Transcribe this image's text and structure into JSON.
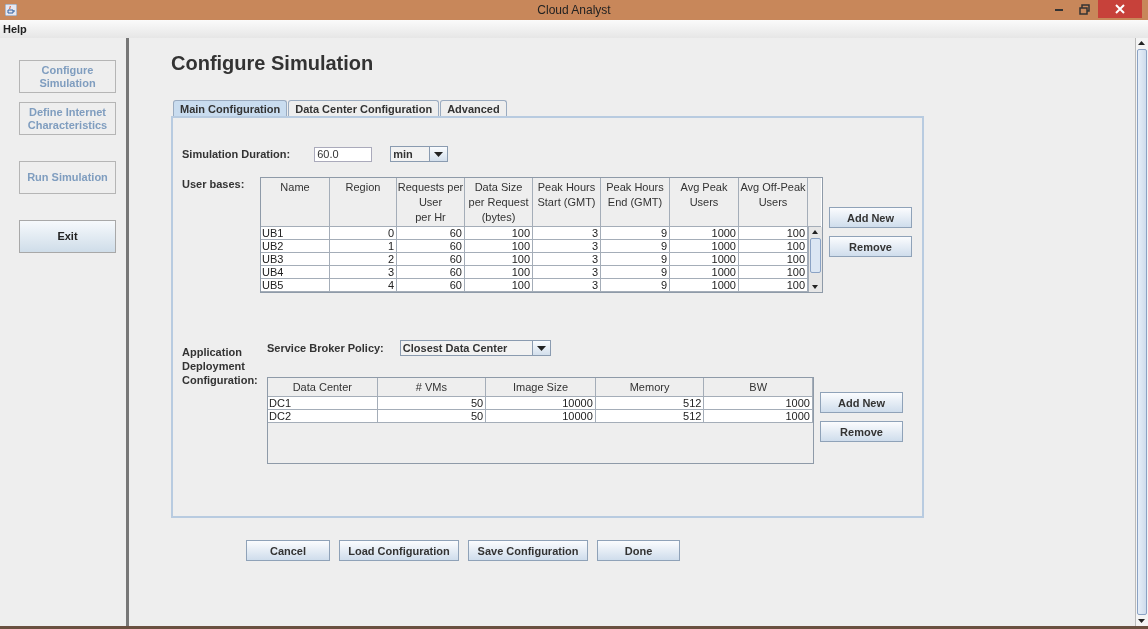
{
  "window": {
    "title": "Cloud Analyst"
  },
  "menu": [
    "Help"
  ],
  "sidebar": {
    "buttons": [
      {
        "label": "Configure\nSimulation",
        "disabled": true
      },
      {
        "label": "Define Internet\nCharacteristics",
        "disabled": true
      },
      {
        "label": "Run Simulation",
        "disabled": true
      },
      {
        "label": "Exit",
        "disabled": false
      }
    ]
  },
  "page_title": "Configure Simulation",
  "tabs": [
    {
      "label": "Main Configuration",
      "selected": true
    },
    {
      "label": "Data Center Configuration",
      "selected": false
    },
    {
      "label": "Advanced",
      "selected": false
    }
  ],
  "duration": {
    "label": "Simulation Duration:",
    "value": "60.0",
    "unit": "min"
  },
  "user_bases": {
    "label": "User bases:",
    "columns": [
      "Name",
      "Region",
      "Requests per\nUser\nper Hr",
      "Data Size\nper Request\n(bytes)",
      "Peak Hours\nStart (GMT)",
      "Peak Hours\nEnd (GMT)",
      "Avg Peak\nUsers",
      "Avg Off-Peak\nUsers"
    ],
    "rows": [
      [
        "UB1",
        "0",
        "60",
        "100",
        "3",
        "9",
        "1000",
        "100"
      ],
      [
        "UB2",
        "1",
        "60",
        "100",
        "3",
        "9",
        "1000",
        "100"
      ],
      [
        "UB3",
        "2",
        "60",
        "100",
        "3",
        "9",
        "1000",
        "100"
      ],
      [
        "UB4",
        "3",
        "60",
        "100",
        "3",
        "9",
        "1000",
        "100"
      ],
      [
        "UB5",
        "4",
        "60",
        "100",
        "3",
        "9",
        "1000",
        "100"
      ]
    ],
    "buttons": [
      "Add New",
      "Remove"
    ]
  },
  "deployment": {
    "label": "Application\nDeployment\nConfiguration:",
    "policy_label": "Service Broker Policy:",
    "policy": "Closest Data Center",
    "columns": [
      "Data Center",
      "# VMs",
      "Image Size",
      "Memory",
      "BW"
    ],
    "rows": [
      [
        "DC1",
        "50",
        "10000",
        "512",
        "1000"
      ],
      [
        "DC2",
        "50",
        "10000",
        "512",
        "1000"
      ]
    ],
    "buttons": [
      "Add New",
      "Remove"
    ]
  },
  "footer_buttons": [
    "Cancel",
    "Load Configuration",
    "Save Configuration",
    "Done"
  ]
}
